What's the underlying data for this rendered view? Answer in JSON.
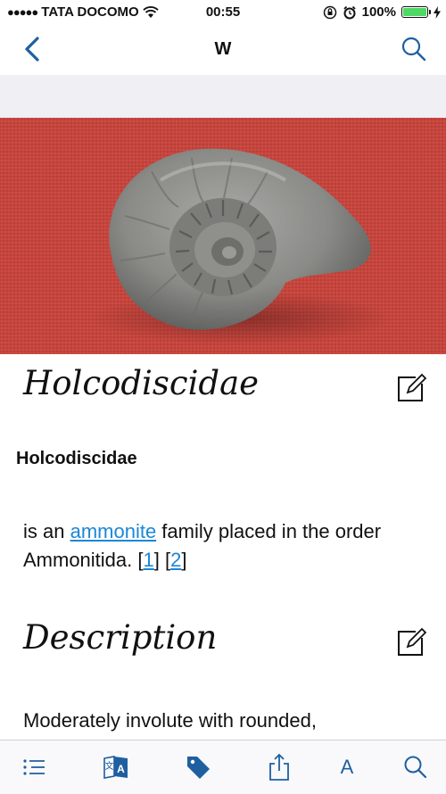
{
  "status_bar": {
    "carrier": "TATA DOCOMO",
    "time": "00:55",
    "battery_percent": "100%",
    "battery_level": 1.0
  },
  "nav": {
    "title": "W"
  },
  "article": {
    "title": "Holcodiscidae",
    "bold_title": "Holcodiscidae",
    "intro_before": "is an ",
    "intro_link": "ammonite",
    "intro_after": " family placed in the order Ammonitida. [",
    "ref1": "1",
    "ref_sep": "] [",
    "ref2": "2",
    "ref_end": "]",
    "section_title": "Description",
    "section_text": "Moderately involute with rounded,"
  },
  "tab_bar": {
    "font_label": "A"
  },
  "colors": {
    "accent": "#1f5fa0",
    "link": "#1b87d6",
    "hero_background": "#c8463e"
  }
}
